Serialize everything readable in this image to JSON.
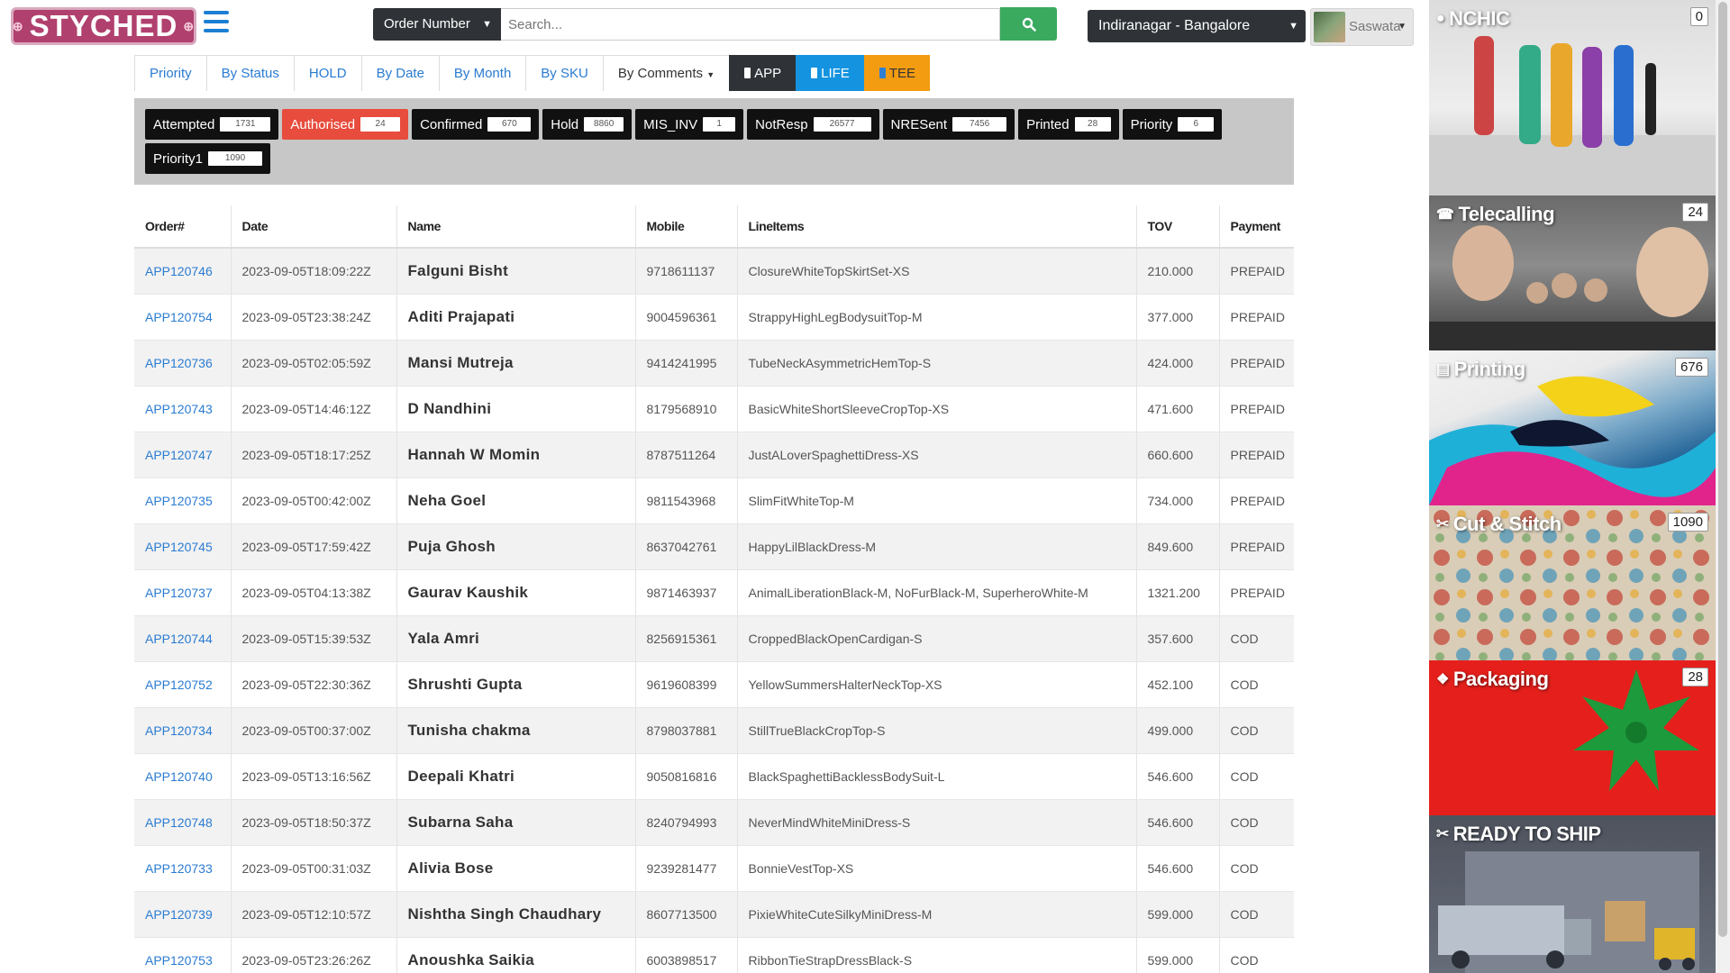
{
  "header": {
    "logo": "STYCHED",
    "search_type": "Order Number",
    "search_placeholder": "Search...",
    "store": "Indiranagar - Bangalore",
    "user": "Saswata"
  },
  "tabs": [
    {
      "label": "Priority"
    },
    {
      "label": "By Status"
    },
    {
      "label": "HOLD"
    },
    {
      "label": "By Date"
    },
    {
      "label": "By Month"
    },
    {
      "label": "By SKU"
    },
    {
      "label": "By Comments"
    },
    {
      "label": "APP"
    },
    {
      "label": "LIFE"
    },
    {
      "label": "TEE"
    }
  ],
  "statuses": [
    {
      "label": "Attempted",
      "count": "1731"
    },
    {
      "label": "Authorised",
      "count": "24"
    },
    {
      "label": "Confirmed",
      "count": "670"
    },
    {
      "label": "Hold",
      "count": "8860"
    },
    {
      "label": "MIS_INV",
      "count": "1"
    },
    {
      "label": "NotResp",
      "count": "26577"
    },
    {
      "label": "NRESent",
      "count": "7456"
    },
    {
      "label": "Printed",
      "count": "28"
    },
    {
      "label": "Priority",
      "count": "6"
    },
    {
      "label": "Priority1",
      "count": "1090"
    }
  ],
  "table": {
    "columns": [
      "Order#",
      "Date",
      "Name",
      "Mobile",
      "LineItems",
      "TOV",
      "Payment"
    ],
    "rows": [
      [
        "APP120746",
        "2023-09-05T18:09:22Z",
        "Falguni Bisht",
        "9718611137",
        "ClosureWhiteTopSkirtSet-XS",
        "210.000",
        "PREPAID"
      ],
      [
        "APP120754",
        "2023-09-05T23:38:24Z",
        "Aditi Prajapati",
        "9004596361",
        "StrappyHighLegBodysuitTop-M",
        "377.000",
        "PREPAID"
      ],
      [
        "APP120736",
        "2023-09-05T02:05:59Z",
        "Mansi Mutreja",
        "9414241995",
        "TubeNeckAsymmetricHemTop-S",
        "424.000",
        "PREPAID"
      ],
      [
        "APP120743",
        "2023-09-05T14:46:12Z",
        "D Nandhini",
        "8179568910",
        "BasicWhiteShortSleeveCropTop-XS",
        "471.600",
        "PREPAID"
      ],
      [
        "APP120747",
        "2023-09-05T18:17:25Z",
        "Hannah W Momin",
        "8787511264",
        "JustALoverSpaghettiDress-XS",
        "660.600",
        "PREPAID"
      ],
      [
        "APP120735",
        "2023-09-05T00:42:00Z",
        "Neha Goel",
        "9811543968",
        "SlimFitWhiteTop-M",
        "734.000",
        "PREPAID"
      ],
      [
        "APP120745",
        "2023-09-05T17:59:42Z",
        "Puja Ghosh",
        "8637042761",
        "HappyLilBlackDress-M",
        "849.600",
        "PREPAID"
      ],
      [
        "APP120737",
        "2023-09-05T04:13:38Z",
        "Gaurav Kaushik",
        "9871463937",
        "AnimalLiberationBlack-M, NoFurBlack-M, SuperheroWhite-M",
        "1321.200",
        "PREPAID"
      ],
      [
        "APP120744",
        "2023-09-05T15:39:53Z",
        "Yala Amri",
        "8256915361",
        "CroppedBlackOpenCardigan-S",
        "357.600",
        "COD"
      ],
      [
        "APP120752",
        "2023-09-05T22:30:36Z",
        "Shrushti Gupta",
        "9619608399",
        "YellowSummersHalterNeckTop-XS",
        "452.100",
        "COD"
      ],
      [
        "APP120734",
        "2023-09-05T00:37:00Z",
        "Tunisha chakma",
        "8798037881",
        "StillTrueBlackCropTop-S",
        "499.000",
        "COD"
      ],
      [
        "APP120740",
        "2023-09-05T13:16:56Z",
        "Deepali Khatri",
        "9050816816",
        "BlackSpaghettiBacklessBodySuit-L",
        "546.600",
        "COD"
      ],
      [
        "APP120748",
        "2023-09-05T18:50:37Z",
        "Subarna Saha",
        "8240794993",
        "NeverMindWhiteMiniDress-S",
        "546.600",
        "COD"
      ],
      [
        "APP120733",
        "2023-09-05T00:31:03Z",
        "Alivia Bose",
        "9239281477",
        "BonnieVestTop-XS",
        "546.600",
        "COD"
      ],
      [
        "APP120739",
        "2023-09-05T12:10:57Z",
        "Nishtha Singh Chaudhary",
        "8607713500",
        "PixieWhiteCuteSilkyMiniDress-M",
        "599.000",
        "COD"
      ],
      [
        "APP120753",
        "2023-09-05T23:26:26Z",
        "Anoushka Saikia",
        "6003898517",
        "RibbonTieStrapDressBlack-S",
        "599.000",
        "COD"
      ]
    ]
  },
  "panels": [
    {
      "title": "NCHIC",
      "count": "0",
      "icon": "user-icon"
    },
    {
      "title": "Telecalling",
      "count": "24",
      "icon": "phone-icon"
    },
    {
      "title": "Printing",
      "count": "676",
      "icon": "print-icon"
    },
    {
      "title": "Cut & Stitch",
      "count": "1090",
      "icon": "scissors-icon"
    },
    {
      "title": "Packaging",
      "count": "28",
      "icon": "cubes-icon"
    },
    {
      "title": "READY TO SHIP",
      "count": "",
      "icon": "scissors-icon"
    }
  ],
  "colors": {
    "brand": "#b0406e",
    "link": "#2a7bd1",
    "search_button": "#3aaa5f",
    "authorised": "#e74c3c",
    "life_tab": "#1493e0",
    "tee_tab": "#f39c12"
  }
}
